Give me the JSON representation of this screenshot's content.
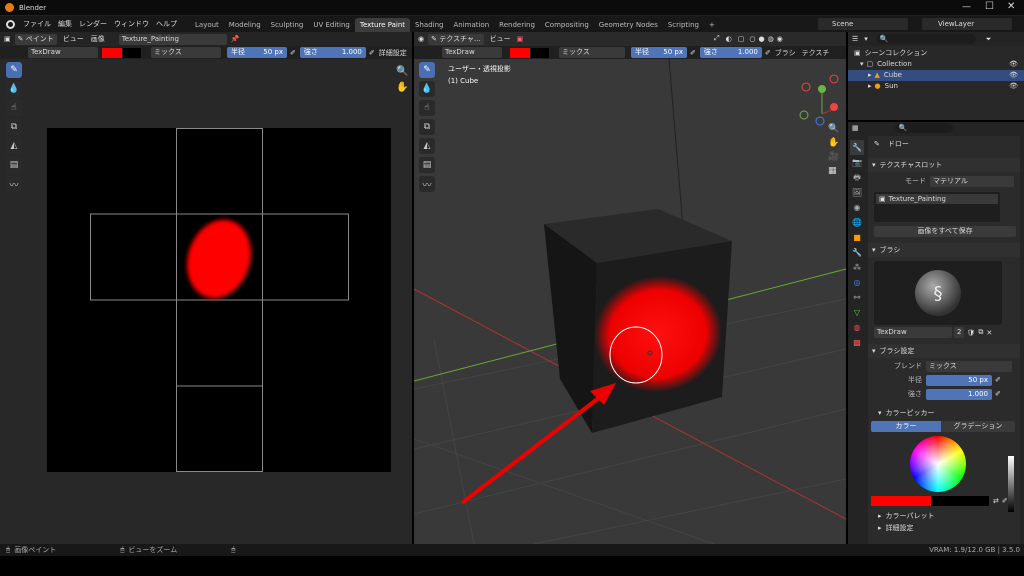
{
  "app": {
    "title": "Blender"
  },
  "menu": [
    "ファイル",
    "編集",
    "レンダー",
    "ウィンドウ",
    "ヘルプ"
  ],
  "workspaces": [
    "Layout",
    "Modeling",
    "Sculpting",
    "UV Editing",
    "Texture Paint",
    "Shading",
    "Animation",
    "Rendering",
    "Compositing",
    "Geometry Nodes",
    "Scripting"
  ],
  "active_workspace": "Texture Paint",
  "scene": "Scene",
  "view_layer": "ViewLayer",
  "image_editor": {
    "mode": "ペイント",
    "menus": [
      "ビュー",
      "画像"
    ],
    "image_name": "Texture_Painting",
    "brush": "TexDraw",
    "blend": "ミックス",
    "radius_label": "半径",
    "radius_value": "50 px",
    "strength_label": "強さ",
    "strength_value": "1.000",
    "detail": "詳細設定"
  },
  "viewport": {
    "mode": "テクスチャ...",
    "menus": [
      "ビュー"
    ],
    "brush": "TexDraw",
    "blend": "ミックス",
    "radius_label": "半径",
    "radius_value": "50 px",
    "strength_label": "強さ",
    "strength_value": "1.000",
    "brush_menu": "ブラシ",
    "texture_menu": "テクスチ",
    "view_name": "ユーザー・透視投影",
    "object_name": "(1) Cube"
  },
  "outliner": {
    "root": "シーンコレクション",
    "items": [
      {
        "name": "Collection",
        "level": 1
      },
      {
        "name": "Cube",
        "level": 2,
        "selected": true
      },
      {
        "name": "Sun",
        "level": 2
      }
    ]
  },
  "properties": {
    "tool_name": "ドロー",
    "texture_slot": {
      "header": "テクスチャスロット",
      "mode_label": "モード",
      "mode_value": "マテリアル",
      "slot": "Texture_Painting",
      "save_all": "画像をすべて保存"
    },
    "brush": {
      "header": "ブラシ",
      "name": "TexDraw",
      "users": "2"
    },
    "brush_settings": {
      "header": "ブラシ設定",
      "blend_label": "ブレンド",
      "blend_value": "ミックス",
      "radius_label": "半径",
      "radius_value": "50 px",
      "strength_label": "強さ",
      "strength_value": "1.000"
    },
    "color_picker": {
      "header": "カラーピッカー",
      "tab_color": "カラー",
      "tab_gradient": "グラデーション"
    },
    "color_palette": "カラーパレット",
    "advanced": "詳細設定"
  },
  "statusbar": {
    "left_action": "画像ペイント",
    "mid_action": "ビューをズーム",
    "right": "VRAM: 1.9/12.0 GB | 3.5.0"
  },
  "colors": {
    "paint": "#ff0000",
    "accent": "#4f75b8"
  }
}
